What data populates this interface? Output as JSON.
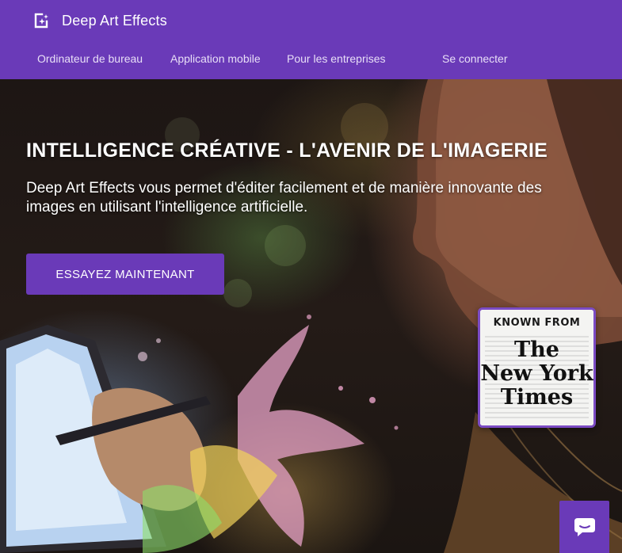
{
  "header": {
    "brand_name": "Deep Art Effects",
    "logo_icon": "sparkle-frame-icon",
    "nav": [
      {
        "label": "Ordinateur de bureau"
      },
      {
        "label": "Application mobile"
      },
      {
        "label": "Pour les entreprises"
      },
      {
        "label": "Se connecter"
      }
    ]
  },
  "hero": {
    "title": "INTELLIGENCE CRÉATIVE - L'AVENIR DE L'IMAGERIE",
    "subtitle": "Deep Art Effects vous permet d'éditer facilement et de manière innovante des images en utilisant l'intelligence artificielle.",
    "cta_label": "ESSAYEZ MAINTENANT"
  },
  "badge": {
    "label": "KNOWN FROM",
    "publication_lines": [
      "The",
      "New York",
      "Times"
    ]
  },
  "chat": {
    "icon": "chat-bubble-icon"
  },
  "colors": {
    "brand_purple": "#6a3ab8",
    "nav_text": "#e8def7",
    "white": "#ffffff"
  }
}
